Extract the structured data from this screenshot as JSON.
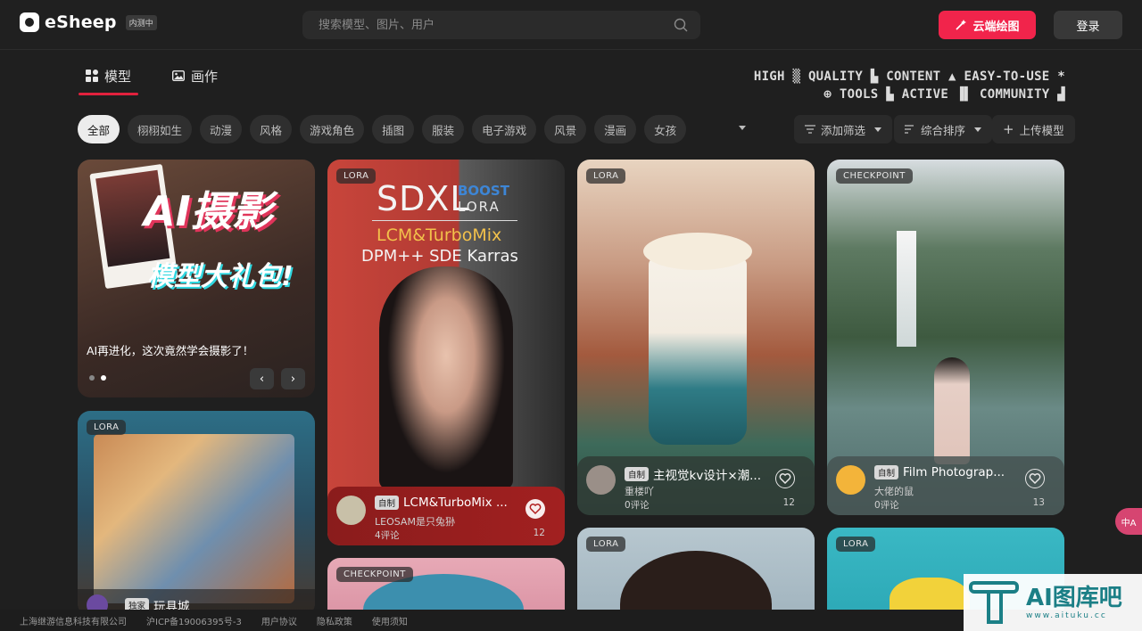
{
  "header": {
    "logo_text": "eSheep",
    "logo_badge": "内测中",
    "search_placeholder": "搜索模型、图片、用户",
    "cloud_button": "云端绘图",
    "login_button": "登录"
  },
  "tabs": [
    {
      "label": "模型",
      "active": true
    },
    {
      "label": "画作",
      "active": false
    }
  ],
  "slogan": {
    "line1": "HIGH ▒ QUALITY ▙ CONTENT ▲ EASY-TO-USE *",
    "line2": "⊕ TOOLS ▙ ACTIVE ▐▌ COMMUNITY ▟"
  },
  "categories": [
    "全部",
    "栩栩如生",
    "动漫",
    "风格",
    "游戏角色",
    "插图",
    "服装",
    "电子游戏",
    "风景",
    "漫画",
    "女孩"
  ],
  "tools": {
    "filter": "添加筛选",
    "sort": "综合排序",
    "upload": "上传模型"
  },
  "banner": {
    "headline": "AI摄影",
    "subheadline": "模型大礼包!",
    "caption": "AI再进化，这次竟然学会摄影了！"
  },
  "cards": [
    {
      "tag": "LORA",
      "poster_line1": "SDXL",
      "poster_boost": "BOOST",
      "poster_lora": "LORA",
      "poster_line2": "LCM&TurboMix",
      "poster_line3": "DPM++ SDE Karras",
      "badge": "自制",
      "title": "LCM&TurboMix ...",
      "author": "LEOSAM是只兔狲",
      "comments": "4评论",
      "likes": "12"
    },
    {
      "tag": "LORA",
      "badge": "自制",
      "title": "主视觉kv设计×潮...",
      "author": "重楼吖",
      "comments": "0评论",
      "likes": "12"
    },
    {
      "tag": "CHECKPOINT",
      "badge": "自制",
      "title": "Film Photograp...",
      "author": "大佬的鼠",
      "comments": "0评论",
      "likes": "13"
    },
    {
      "tag": "LORA",
      "badge": "独家",
      "title": "玩具城"
    },
    {
      "tag": "CHECKPOINT"
    },
    {
      "tag": "LORA"
    },
    {
      "tag": "LORA"
    }
  ],
  "footer": [
    "上海继游信息科技有限公司",
    "沪ICP备19006395号-3",
    "用户协议",
    "隐私政策",
    "使用须知"
  ],
  "side_translate": "中A",
  "watermark": {
    "main": "AI图库吧",
    "sub": "www.aituku.cc"
  },
  "colors": {
    "accent": "#f1244b",
    "background": "#1f1f1f"
  }
}
